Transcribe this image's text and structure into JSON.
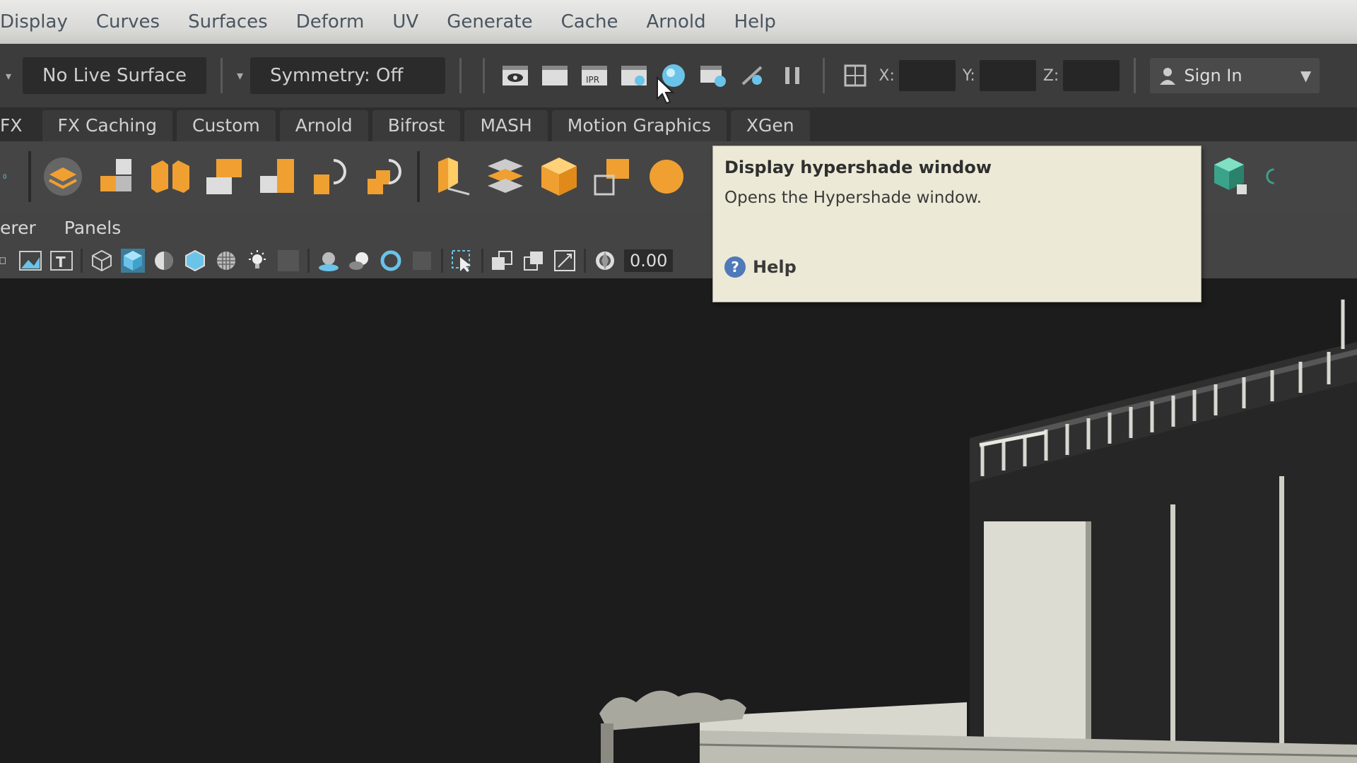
{
  "menubar": {
    "items": [
      "Display",
      "Curves",
      "Surfaces",
      "Deform",
      "UV",
      "Generate",
      "Cache",
      "Arnold",
      "Help"
    ]
  },
  "statusline": {
    "live_surface": "No Live Surface",
    "symmetry": "Symmetry: Off",
    "coord_x_label": "X:",
    "coord_y_label": "Y:",
    "coord_z_label": "Z:",
    "sign_in": "Sign In"
  },
  "shelf_tabs": [
    "FX",
    "FX Caching",
    "Custom",
    "Arnold",
    "Bifrost",
    "MASH",
    "Motion Graphics",
    "XGen"
  ],
  "panel_menu": [
    "erer",
    "Panels"
  ],
  "panel_toolbar": {
    "value": "0.00"
  },
  "tooltip": {
    "title": "Display hypershade window",
    "description": "Opens the Hypershade window.",
    "help_label": "Help",
    "help_icon": "?"
  },
  "colors": {
    "shelf_orange": "#f0a030",
    "shelf_green": "#3aa38a",
    "highlight_blue": "#6ac3e8"
  }
}
